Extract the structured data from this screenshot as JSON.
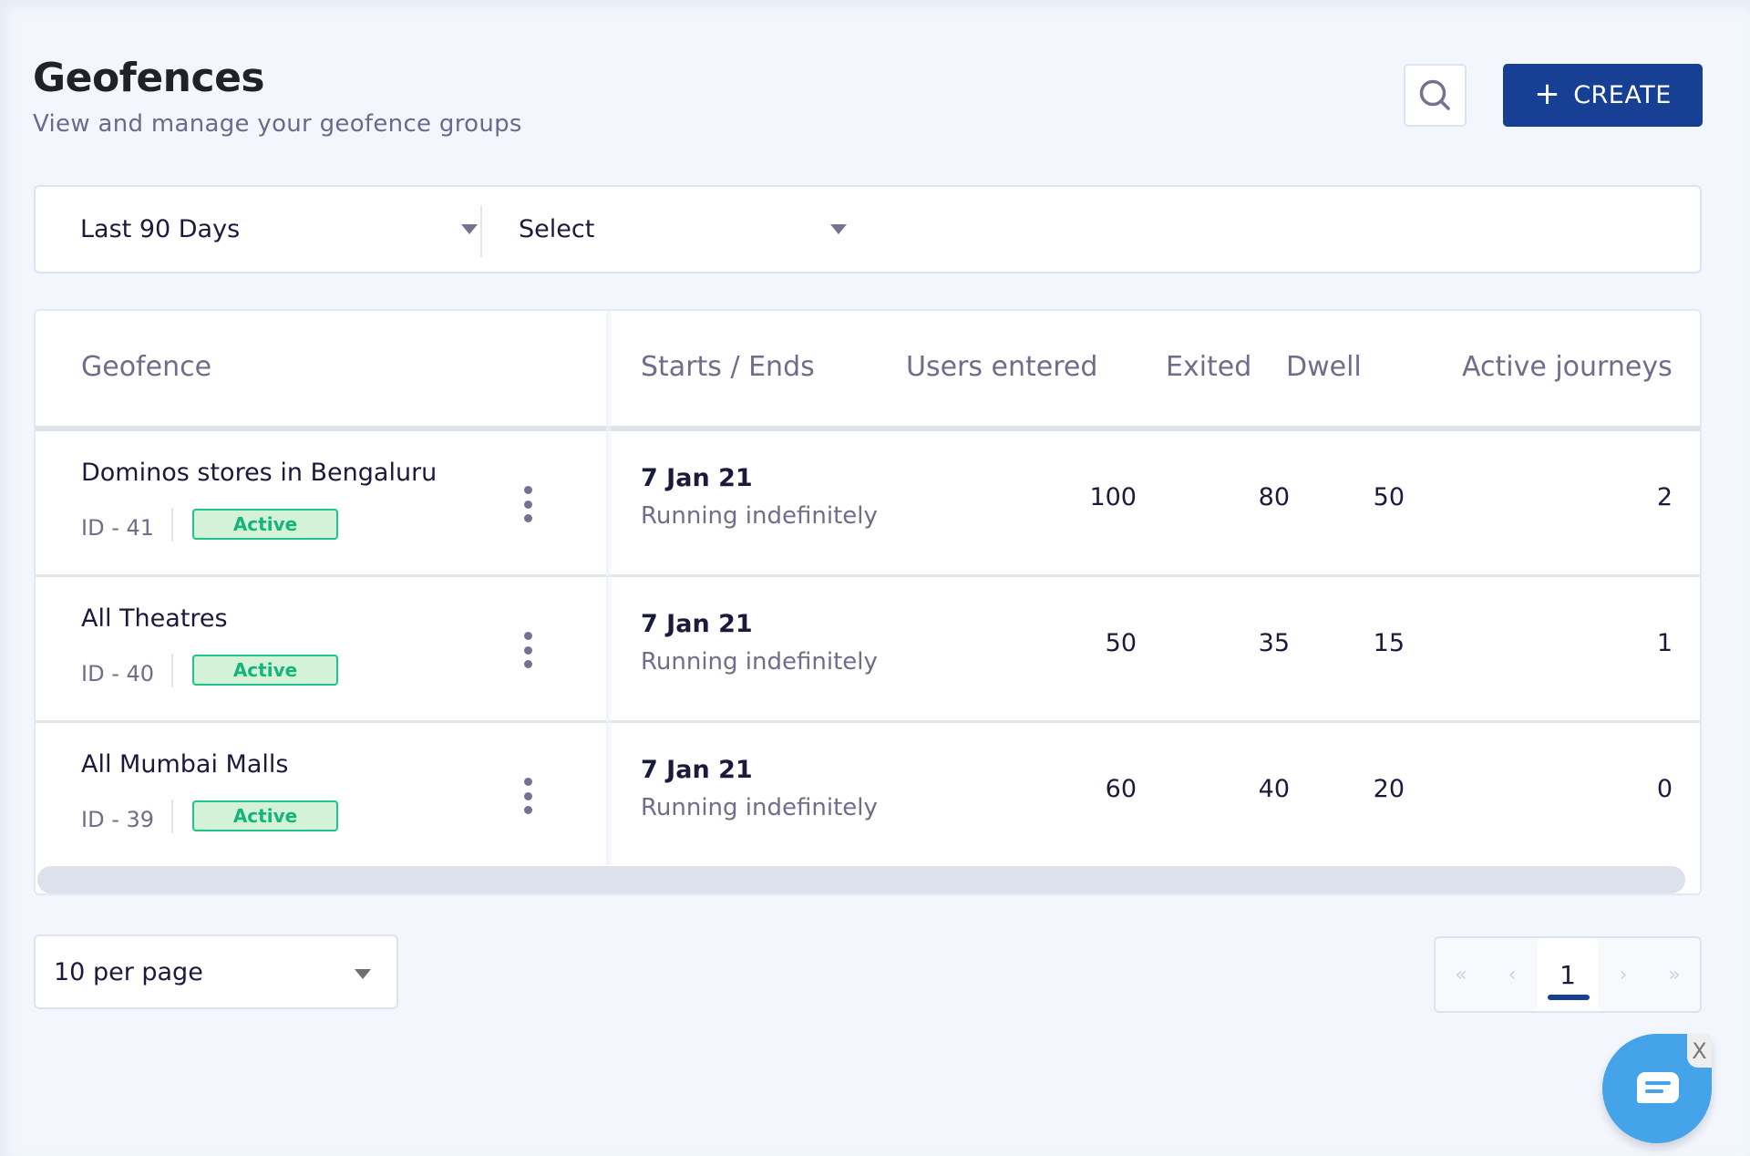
{
  "header": {
    "title": "Geofences",
    "subtitle": "View and manage your geofence groups",
    "search_icon": "search-icon",
    "create_label": "CREATE",
    "create_icon": "+"
  },
  "filters": {
    "date_range": "Last 90 Days",
    "select": "Select"
  },
  "table": {
    "columns": [
      "Geofence",
      "Starts / Ends",
      "Users entered",
      "Exited",
      "Dwell",
      "Active journeys"
    ],
    "rows": [
      {
        "name": "Dominos stores in Bengaluru",
        "id": "ID - 41",
        "status": "Active",
        "start": "7 Jan 21",
        "end": "Running indefinitely",
        "users_entered": "100",
        "exited": "80",
        "dwell": "50",
        "active_journeys": "2"
      },
      {
        "name": "All Theatres",
        "id": "ID - 40",
        "status": "Active",
        "start": "7 Jan 21",
        "end": "Running indefinitely",
        "users_entered": "50",
        "exited": "35",
        "dwell": "15",
        "active_journeys": "1"
      },
      {
        "name": "All Mumbai Malls",
        "id": "ID - 39",
        "status": "Active",
        "start": "7 Jan 21",
        "end": "Running indefinitely",
        "users_entered": "60",
        "exited": "40",
        "dwell": "20",
        "active_journeys": "0"
      }
    ]
  },
  "pagination": {
    "per_page": "10 per page",
    "first": "«",
    "prev": "‹",
    "current_page": "1",
    "next": "›",
    "last": "»"
  },
  "chat": {
    "close_label": "X"
  },
  "colors": {
    "primary": "#173f94",
    "active_badge_bg": "#d4f2d7",
    "active_badge_border": "#1ec489",
    "active_badge_text": "#13b57a",
    "chat": "#45a3ea"
  }
}
